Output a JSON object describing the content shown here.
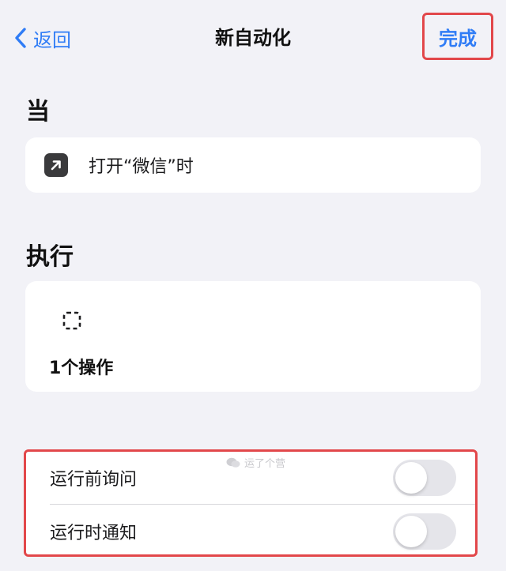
{
  "nav": {
    "back_label": "返回",
    "title": "新自动化",
    "done_label": "完成"
  },
  "when": {
    "header": "当",
    "trigger": {
      "text": "打开“微信”时",
      "icon": "arrow-up-right-icon"
    }
  },
  "do": {
    "header": "执行",
    "action": {
      "text": "1个操作",
      "icon": "dashed-square-icon"
    }
  },
  "settings": {
    "items": [
      {
        "label": "运行前询问",
        "enabled": false
      },
      {
        "label": "运行时通知",
        "enabled": false
      }
    ]
  },
  "watermark": {
    "text": "运了个营"
  },
  "colors": {
    "accent": "#2f7cf6",
    "highlight_border": "#e2474a",
    "background": "#f2f2f7",
    "card": "#ffffff",
    "toggle_off": "#e5e5ea"
  }
}
